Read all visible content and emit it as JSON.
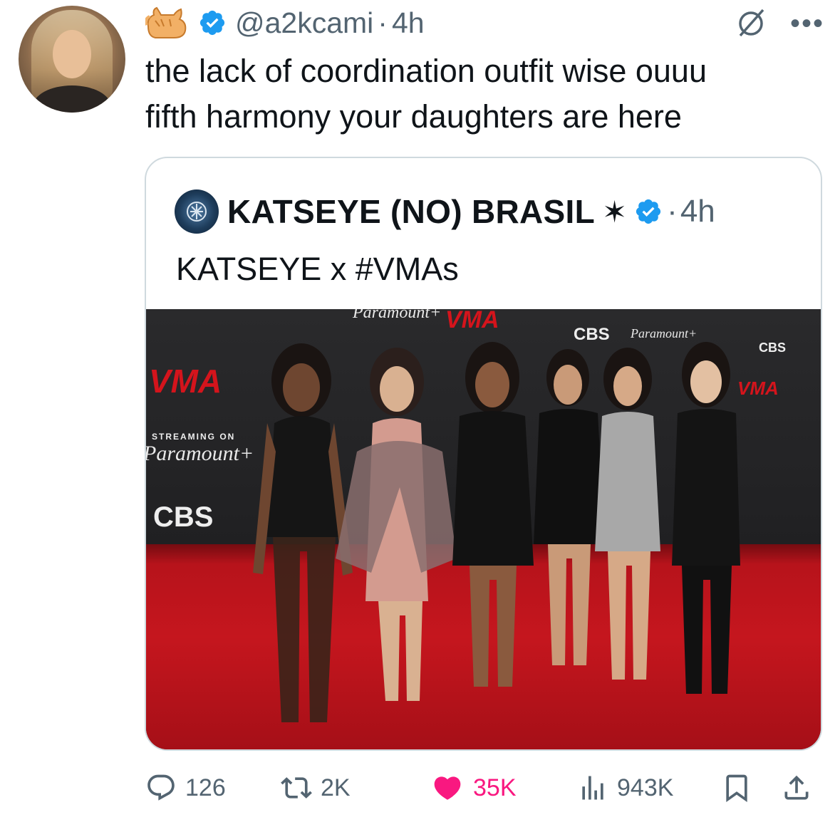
{
  "tweet": {
    "handle": "@a2kcami",
    "separator": "·",
    "time": "4h",
    "text": "the lack of coordination outfit wise ouuu\nfifth harmony your daughters are here",
    "name_emoji_icon": "cat-icon",
    "verified_icon": "verified-badge-icon",
    "top_icons": [
      "grok-icon",
      "more-icon"
    ]
  },
  "quote": {
    "name": "KATSEYE (NO) BRASIL",
    "star": "✶",
    "separator": "·",
    "time": "4h",
    "text": "KATSEYE x #VMAs",
    "verified_icon": "verified-badge-icon",
    "image_alt_icons": [
      "photo"
    ],
    "backdrop_text": {
      "paramount_top": "Paramount+",
      "cbs_top": "CBS",
      "streaming_on": "STREAMING ON",
      "paramount_left": "Paramount+",
      "cbs_left": "CBS",
      "vma": "VMA"
    }
  },
  "actions": {
    "replies": "126",
    "reposts": "2K",
    "likes": "35K",
    "views": "943K"
  },
  "colors": {
    "text": "#0f1419",
    "secondary": "#536471",
    "verified": "#1d9bf0",
    "like": "#f91880",
    "border": "#cfd9de",
    "carpet": "#c5161e"
  }
}
